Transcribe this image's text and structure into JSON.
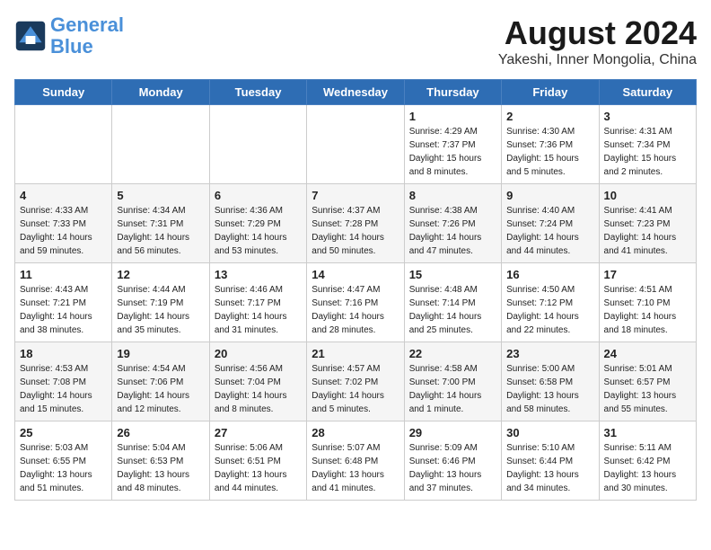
{
  "header": {
    "logo_line1": "General",
    "logo_line2": "Blue",
    "title": "August 2024",
    "subtitle": "Yakeshi, Inner Mongolia, China"
  },
  "weekdays": [
    "Sunday",
    "Monday",
    "Tuesday",
    "Wednesday",
    "Thursday",
    "Friday",
    "Saturday"
  ],
  "weeks": [
    [
      {
        "day": "",
        "info": ""
      },
      {
        "day": "",
        "info": ""
      },
      {
        "day": "",
        "info": ""
      },
      {
        "day": "",
        "info": ""
      },
      {
        "day": "1",
        "info": "Sunrise: 4:29 AM\nSunset: 7:37 PM\nDaylight: 15 hours\nand 8 minutes."
      },
      {
        "day": "2",
        "info": "Sunrise: 4:30 AM\nSunset: 7:36 PM\nDaylight: 15 hours\nand 5 minutes."
      },
      {
        "day": "3",
        "info": "Sunrise: 4:31 AM\nSunset: 7:34 PM\nDaylight: 15 hours\nand 2 minutes."
      }
    ],
    [
      {
        "day": "4",
        "info": "Sunrise: 4:33 AM\nSunset: 7:33 PM\nDaylight: 14 hours\nand 59 minutes."
      },
      {
        "day": "5",
        "info": "Sunrise: 4:34 AM\nSunset: 7:31 PM\nDaylight: 14 hours\nand 56 minutes."
      },
      {
        "day": "6",
        "info": "Sunrise: 4:36 AM\nSunset: 7:29 PM\nDaylight: 14 hours\nand 53 minutes."
      },
      {
        "day": "7",
        "info": "Sunrise: 4:37 AM\nSunset: 7:28 PM\nDaylight: 14 hours\nand 50 minutes."
      },
      {
        "day": "8",
        "info": "Sunrise: 4:38 AM\nSunset: 7:26 PM\nDaylight: 14 hours\nand 47 minutes."
      },
      {
        "day": "9",
        "info": "Sunrise: 4:40 AM\nSunset: 7:24 PM\nDaylight: 14 hours\nand 44 minutes."
      },
      {
        "day": "10",
        "info": "Sunrise: 4:41 AM\nSunset: 7:23 PM\nDaylight: 14 hours\nand 41 minutes."
      }
    ],
    [
      {
        "day": "11",
        "info": "Sunrise: 4:43 AM\nSunset: 7:21 PM\nDaylight: 14 hours\nand 38 minutes."
      },
      {
        "day": "12",
        "info": "Sunrise: 4:44 AM\nSunset: 7:19 PM\nDaylight: 14 hours\nand 35 minutes."
      },
      {
        "day": "13",
        "info": "Sunrise: 4:46 AM\nSunset: 7:17 PM\nDaylight: 14 hours\nand 31 minutes."
      },
      {
        "day": "14",
        "info": "Sunrise: 4:47 AM\nSunset: 7:16 PM\nDaylight: 14 hours\nand 28 minutes."
      },
      {
        "day": "15",
        "info": "Sunrise: 4:48 AM\nSunset: 7:14 PM\nDaylight: 14 hours\nand 25 minutes."
      },
      {
        "day": "16",
        "info": "Sunrise: 4:50 AM\nSunset: 7:12 PM\nDaylight: 14 hours\nand 22 minutes."
      },
      {
        "day": "17",
        "info": "Sunrise: 4:51 AM\nSunset: 7:10 PM\nDaylight: 14 hours\nand 18 minutes."
      }
    ],
    [
      {
        "day": "18",
        "info": "Sunrise: 4:53 AM\nSunset: 7:08 PM\nDaylight: 14 hours\nand 15 minutes."
      },
      {
        "day": "19",
        "info": "Sunrise: 4:54 AM\nSunset: 7:06 PM\nDaylight: 14 hours\nand 12 minutes."
      },
      {
        "day": "20",
        "info": "Sunrise: 4:56 AM\nSunset: 7:04 PM\nDaylight: 14 hours\nand 8 minutes."
      },
      {
        "day": "21",
        "info": "Sunrise: 4:57 AM\nSunset: 7:02 PM\nDaylight: 14 hours\nand 5 minutes."
      },
      {
        "day": "22",
        "info": "Sunrise: 4:58 AM\nSunset: 7:00 PM\nDaylight: 14 hours\nand 1 minute."
      },
      {
        "day": "23",
        "info": "Sunrise: 5:00 AM\nSunset: 6:58 PM\nDaylight: 13 hours\nand 58 minutes."
      },
      {
        "day": "24",
        "info": "Sunrise: 5:01 AM\nSunset: 6:57 PM\nDaylight: 13 hours\nand 55 minutes."
      }
    ],
    [
      {
        "day": "25",
        "info": "Sunrise: 5:03 AM\nSunset: 6:55 PM\nDaylight: 13 hours\nand 51 minutes."
      },
      {
        "day": "26",
        "info": "Sunrise: 5:04 AM\nSunset: 6:53 PM\nDaylight: 13 hours\nand 48 minutes."
      },
      {
        "day": "27",
        "info": "Sunrise: 5:06 AM\nSunset: 6:51 PM\nDaylight: 13 hours\nand 44 minutes."
      },
      {
        "day": "28",
        "info": "Sunrise: 5:07 AM\nSunset: 6:48 PM\nDaylight: 13 hours\nand 41 minutes."
      },
      {
        "day": "29",
        "info": "Sunrise: 5:09 AM\nSunset: 6:46 PM\nDaylight: 13 hours\nand 37 minutes."
      },
      {
        "day": "30",
        "info": "Sunrise: 5:10 AM\nSunset: 6:44 PM\nDaylight: 13 hours\nand 34 minutes."
      },
      {
        "day": "31",
        "info": "Sunrise: 5:11 AM\nSunset: 6:42 PM\nDaylight: 13 hours\nand 30 minutes."
      }
    ]
  ]
}
